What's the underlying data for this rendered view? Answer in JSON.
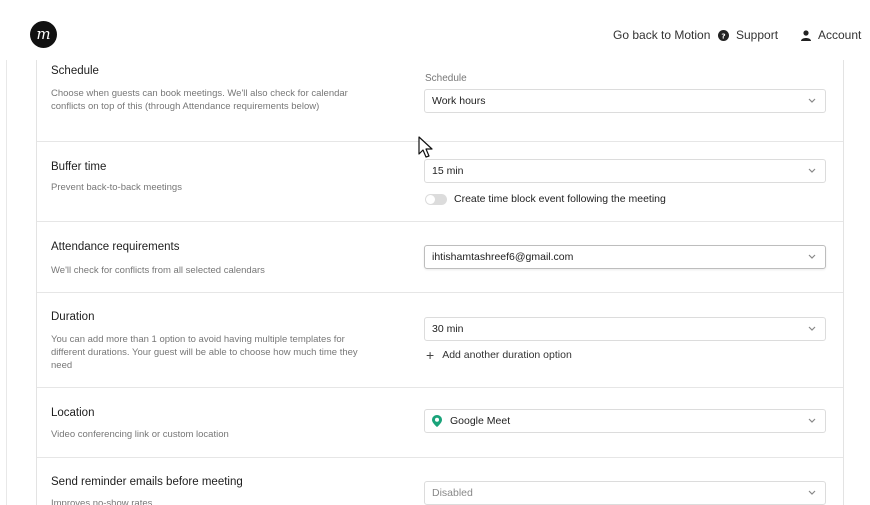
{
  "header": {
    "logo_text": "m",
    "go_back_label": "Go back to Motion",
    "support_label": "Support",
    "account_label": "Account"
  },
  "rows": {
    "schedule": {
      "title": "Schedule",
      "description": "Choose when guests can book meetings. We'll also check for calendar conflicts on top of this (through Attendance requirements below)",
      "field_label": "Schedule",
      "value": "Work hours"
    },
    "buffer": {
      "title": "Buffer time",
      "description": "Prevent back-to-back meetings",
      "value": "15 min",
      "toggle_label": "Create time block event following the meeting",
      "toggle_on": false
    },
    "attendance": {
      "title": "Attendance requirements",
      "description": "We'll check for conflicts from all selected calendars",
      "value": "ihtishamtashreef6@gmail.com"
    },
    "duration": {
      "title": "Duration",
      "description": "You can add more than 1 option to avoid having multiple templates for different durations. Your guest will be able to choose how much time they need",
      "value": "30 min",
      "add_label": "Add another duration option"
    },
    "location": {
      "title": "Location",
      "description": "Video conferencing link or custom location",
      "value": "Google Meet"
    },
    "reminder": {
      "title": "Send reminder emails before meeting",
      "description": "Improves no-show rates",
      "value": "Disabled"
    }
  },
  "colors": {
    "accent_meet": "#1aa37a",
    "border": "#dcdcdc"
  }
}
